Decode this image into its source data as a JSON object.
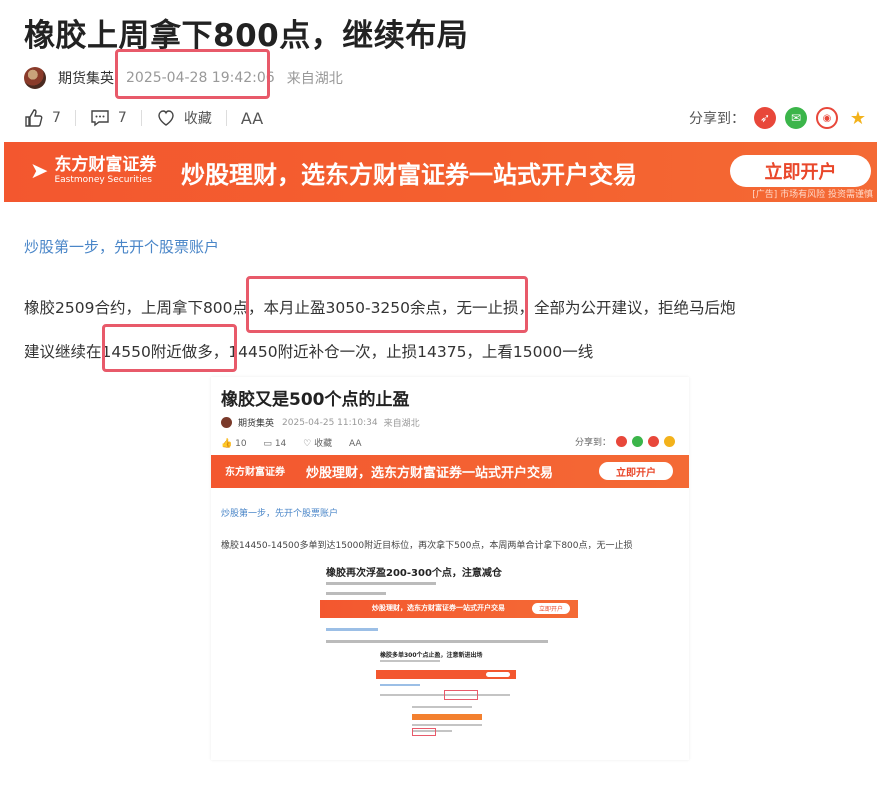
{
  "article": {
    "title": "橡胶上周拿下800点，继续布局",
    "author": "期货集英",
    "timestamp": "2025-04-28 19:42:06",
    "location": "来自湖北"
  },
  "actions": {
    "likes": "7",
    "comments": "7",
    "collect_label": "收藏",
    "font_size_label": "AA",
    "share_label": "分享到："
  },
  "banner": {
    "brand_cn": "东方财富证券",
    "brand_en": "Eastmoney Securities",
    "slogan": "炒股理财，选东方财富证券一站式开户交易",
    "button": "立即开户",
    "ad_note": "[广告] 市场有风险 投资需谨慎"
  },
  "body": {
    "link": "炒股第一步，先开个股票账户",
    "para1": "橡胶2509合约，上周拿下800点，本月止盈3050-3250余点，无一止损，全部为公开建议，拒绝马后炮",
    "para2": "建议继续在14550附近做多，14450附近补仓一次，止损14375，上看15000一线"
  },
  "embedded1": {
    "title": "橡胶又是500个点的止盈",
    "author": "期货集英",
    "timestamp": "2025-04-25 11:10:34",
    "location": "来自湖北",
    "likes": "10",
    "comments": "14",
    "collect_label": "收藏",
    "font_size_label": "AA",
    "share_label": "分享到：",
    "banner_brand": "东方财富证券",
    "banner_slogan": "炒股理财，选东方财富证券一站式开户交易",
    "banner_button": "立即开户",
    "link": "炒股第一步，先开个股票账户",
    "para": "橡胶14450-14500多单到达15000附近目标位，再次拿下500点，本周两单合计拿下800点，无一止损"
  },
  "embedded2": {
    "title": "橡胶再次浮盈200-300个点，注意减仓",
    "banner_slogan": "炒股理财，选东方财富证券一站式开户交易",
    "banner_button": "立即开户"
  },
  "embedded3": {
    "title": "橡胶多单300个点止盈，注意新进出场"
  },
  "colors": {
    "brand_orange": "#f3572f",
    "highlight_red": "#e85a6a",
    "link_blue": "#4a86c8"
  }
}
